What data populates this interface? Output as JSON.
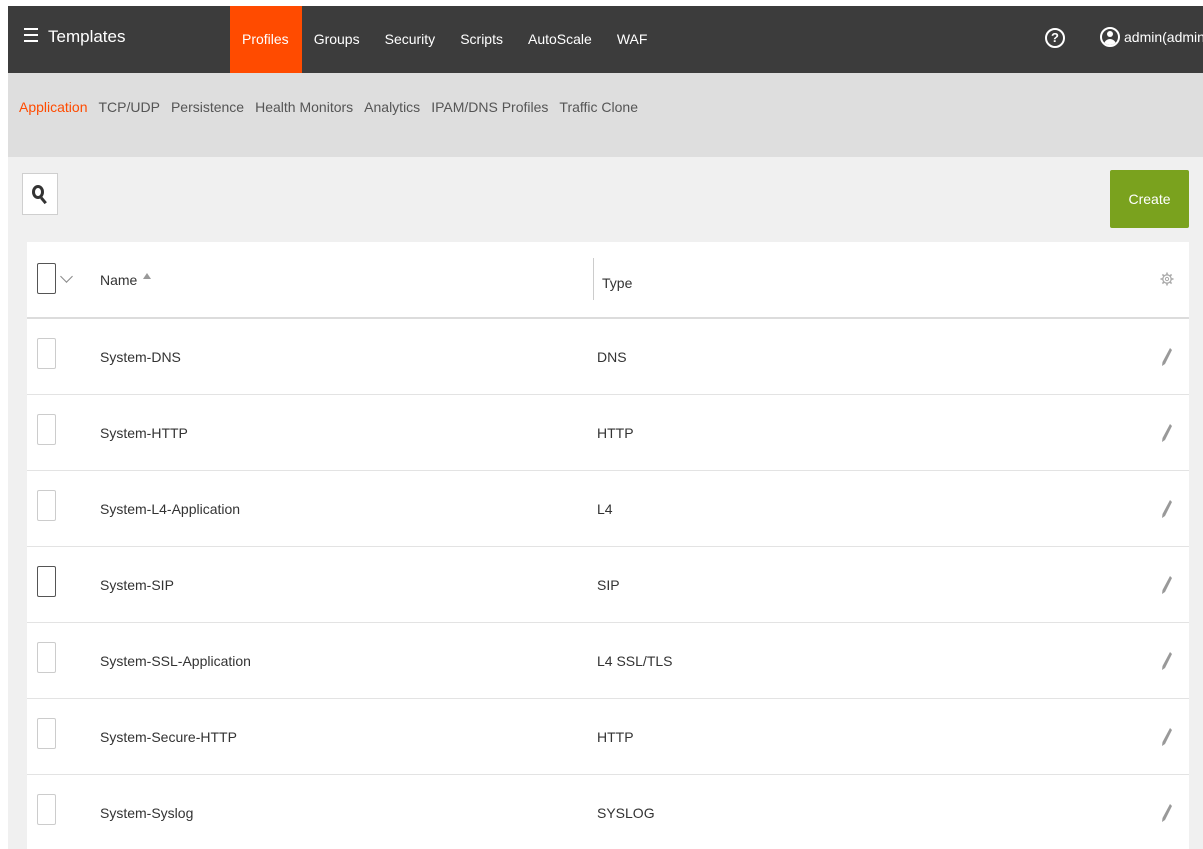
{
  "topbar": {
    "title": "Templates",
    "tabs": [
      {
        "label": "Profiles",
        "active": true
      },
      {
        "label": "Groups",
        "active": false
      },
      {
        "label": "Security",
        "active": false
      },
      {
        "label": "Scripts",
        "active": false
      },
      {
        "label": "AutoScale",
        "active": false
      },
      {
        "label": "WAF",
        "active": false
      }
    ],
    "help_label": "?",
    "user": "admin(admin)"
  },
  "subnav": {
    "items": [
      {
        "label": "Application",
        "active": true
      },
      {
        "label": "TCP/UDP",
        "active": false
      },
      {
        "label": "Persistence",
        "active": false
      },
      {
        "label": "Health Monitors",
        "active": false
      },
      {
        "label": "Analytics",
        "active": false
      },
      {
        "label": "IPAM/DNS Profiles",
        "active": false
      },
      {
        "label": "Traffic Clone",
        "active": false
      }
    ]
  },
  "toolbar": {
    "create_label": "Create"
  },
  "table": {
    "columns": {
      "name": "Name",
      "type": "Type"
    },
    "rows": [
      {
        "name": "System-DNS",
        "type": "DNS"
      },
      {
        "name": "System-HTTP",
        "type": "HTTP"
      },
      {
        "name": "System-L4-Application",
        "type": "L4"
      },
      {
        "name": "System-SIP",
        "type": "SIP"
      },
      {
        "name": "System-SSL-Application",
        "type": "L4 SSL/TLS"
      },
      {
        "name": "System-Secure-HTTP",
        "type": "HTTP"
      },
      {
        "name": "System-Syslog",
        "type": "SYSLOG"
      }
    ]
  },
  "colors": {
    "topbar_bg": "#3c3c3c",
    "accent": "#ff4b00",
    "create_button": "#7aa21e",
    "subnav_bg": "#dedede"
  },
  "icons": [
    "menu-icon",
    "help-icon",
    "user-icon",
    "search-icon",
    "chevron-down-icon",
    "sort-asc-icon",
    "gear-icon",
    "pencil-icon"
  ]
}
